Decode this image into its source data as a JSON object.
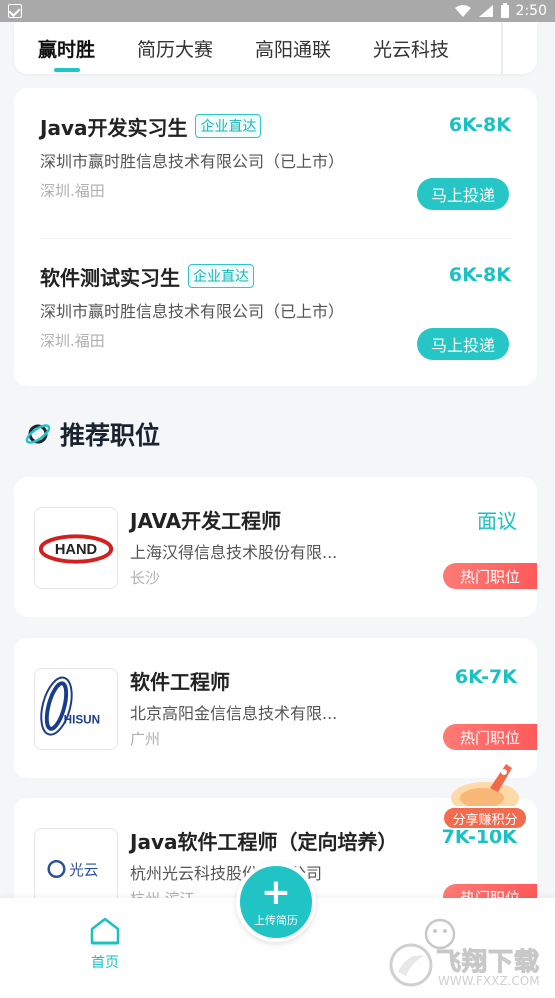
{
  "status_bar": {
    "time": "2:50"
  },
  "company_tabs": [
    {
      "label": "赢时胜",
      "active": true
    },
    {
      "label": "简历大赛",
      "active": false
    },
    {
      "label": "高阳通联",
      "active": false
    },
    {
      "label": "光云科技",
      "active": false
    }
  ],
  "jobs": [
    {
      "title": "Java开发实习生",
      "tag": "企业直达",
      "salary": "6K-8K",
      "company": "深圳市赢时胜信息技术有限公司（已上市）",
      "location": "深圳.福田",
      "apply_label": "马上投递"
    },
    {
      "title": "软件测试实习生",
      "tag": "企业直达",
      "salary": "6K-8K",
      "company": "深圳市赢时胜信息技术有限公司（已上市）",
      "location": "深圳.福田",
      "apply_label": "马上投递"
    }
  ],
  "recommended": {
    "title": "推荐职位",
    "items": [
      {
        "title": "JAVA开发工程师",
        "salary": "面议",
        "company": "上海汉得信息技术股份有限...",
        "location": "长沙",
        "hot_tag": "热门职位",
        "logo_text": "HAND"
      },
      {
        "title": "软件工程师",
        "salary": "6K-7K",
        "company": "北京高阳金信信息技术有限...",
        "location": "广州",
        "hot_tag": "热门职位",
        "logo_text": "HISUN"
      },
      {
        "title": "Java软件工程师（定向培养）",
        "salary": "7K-10K",
        "company": "杭州光云科技股份有限公司",
        "location": "杭州.滨江",
        "hot_tag": "热门职位",
        "logo_text": "光云"
      }
    ]
  },
  "share_float": {
    "label": "分享赚积分"
  },
  "bottom_nav": {
    "home_label": "首页",
    "upload_label": "上传简历"
  },
  "watermark": {
    "text": "飞翔下载",
    "url": "WWW.FXXZ.COM"
  }
}
